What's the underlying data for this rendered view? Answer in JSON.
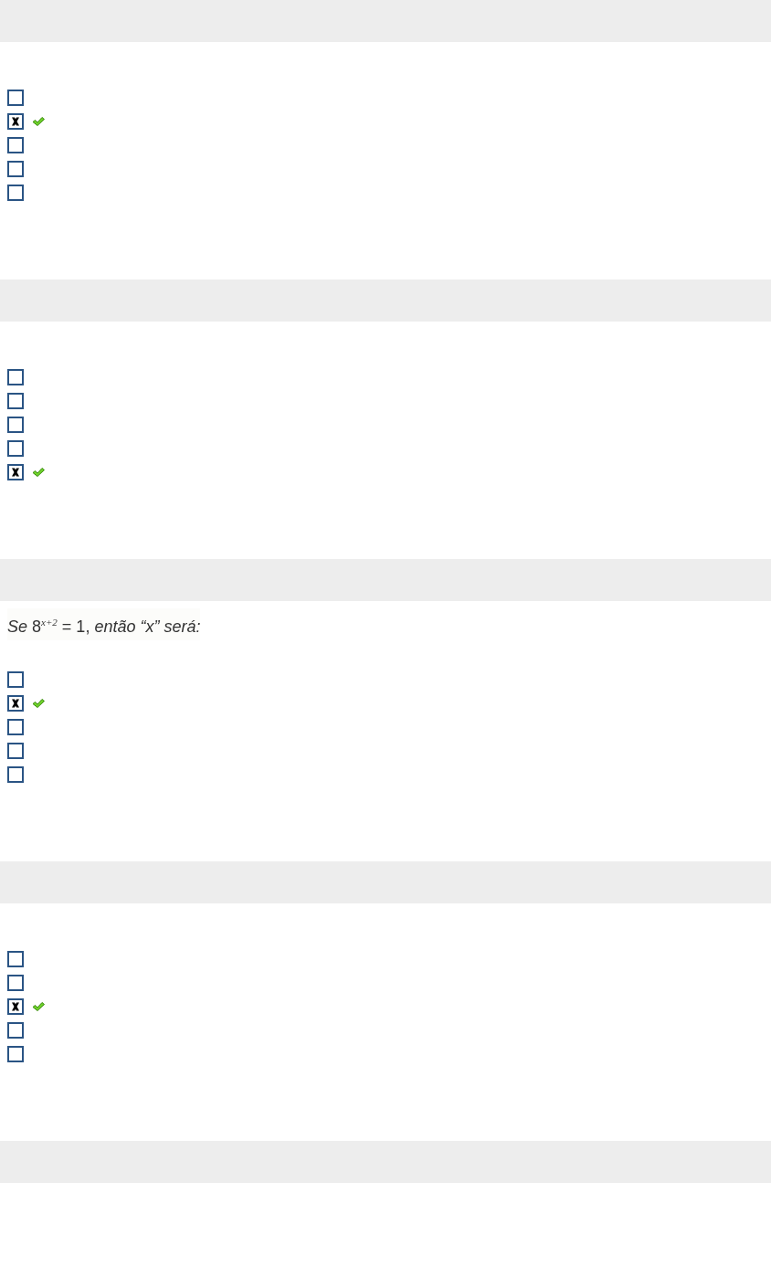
{
  "questions": [
    {
      "options": [
        {
          "checked": false,
          "correct": false
        },
        {
          "checked": true,
          "correct": true
        },
        {
          "checked": false,
          "correct": false
        },
        {
          "checked": false,
          "correct": false
        },
        {
          "checked": false,
          "correct": false
        }
      ]
    },
    {
      "options": [
        {
          "checked": false,
          "correct": false
        },
        {
          "checked": false,
          "correct": false
        },
        {
          "checked": false,
          "correct": false
        },
        {
          "checked": false,
          "correct": false
        },
        {
          "checked": true,
          "correct": true
        }
      ]
    },
    {
      "prompt": "*Se* 8$^{x+2}$ = 1, *então “x” será:*",
      "options": [
        {
          "checked": false,
          "correct": false
        },
        {
          "checked": true,
          "correct": true
        },
        {
          "checked": false,
          "correct": false
        },
        {
          "checked": false,
          "correct": false
        },
        {
          "checked": false,
          "correct": false
        }
      ]
    },
    {
      "options": [
        {
          "checked": false,
          "correct": false
        },
        {
          "checked": false,
          "correct": false
        },
        {
          "checked": true,
          "correct": true
        },
        {
          "checked": false,
          "correct": false
        },
        {
          "checked": false,
          "correct": false
        }
      ]
    }
  ],
  "trailing_header": true
}
